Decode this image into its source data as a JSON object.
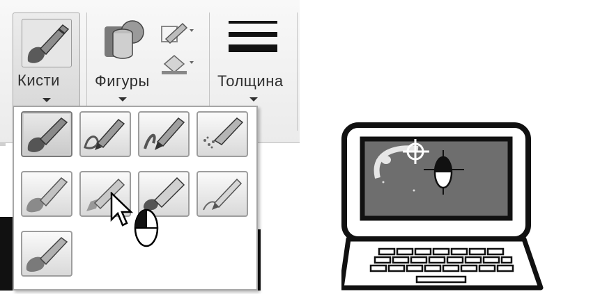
{
  "ribbon": {
    "brushes": {
      "label": "Кисти",
      "icon": "brush-icon"
    },
    "shapes": {
      "label": "Фигуры",
      "icon": "shapes-icon"
    },
    "outline": {
      "icon": "pencil-outline-icon"
    },
    "fill": {
      "icon": "fill-bucket-icon"
    },
    "thickness": {
      "label": "Толщина",
      "icon": "line-thickness-icon"
    }
  },
  "dropdown": {
    "items": [
      {
        "name": "brush",
        "selected": true
      },
      {
        "name": "calligraphy-brush-1"
      },
      {
        "name": "calligraphy-brush-2"
      },
      {
        "name": "airbrush"
      },
      {
        "name": "oil-brush"
      },
      {
        "name": "crayon"
      },
      {
        "name": "marker"
      },
      {
        "name": "natural-pencil"
      },
      {
        "name": "watercolor-brush"
      }
    ]
  },
  "colors": {
    "ribbon": "#ebebeb",
    "screen": "#6e6e6e",
    "frame": "#111111"
  }
}
